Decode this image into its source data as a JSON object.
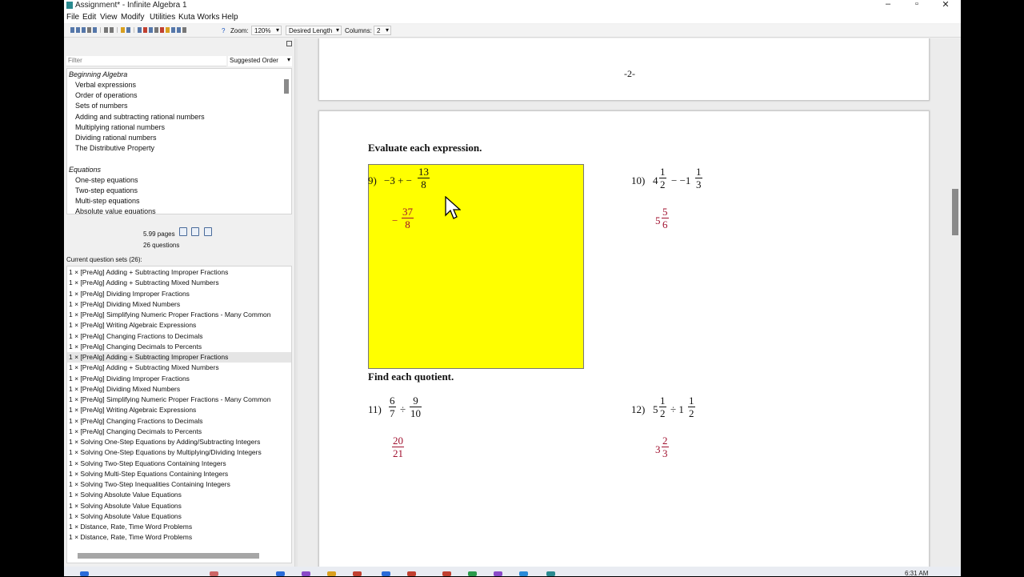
{
  "window": {
    "title": "Assignment* - Infinite Algebra 1",
    "controls": {
      "minimize": "–",
      "maximize": "▫",
      "close": "✕"
    }
  },
  "menu": [
    "File",
    "Edit",
    "View",
    "Modify",
    "Utilities",
    "Kuta Works",
    "Help"
  ],
  "toolbar": {
    "help": "?",
    "zoom_label": "Zoom:",
    "zoom_value": "120%",
    "length_value": "Desired Length",
    "columns_label": "Columns:",
    "columns_value": "2"
  },
  "left_pane": {
    "filter_placeholder": "Filter",
    "order_value": "Suggested Order",
    "topics": [
      {
        "group": "Beginning Algebra",
        "items": [
          "Verbal expressions",
          "Order of operations",
          "Sets of numbers",
          "Adding and subtracting rational numbers",
          "Multiplying rational numbers",
          "Dividing rational numbers",
          "The Distributive Property"
        ]
      },
      {
        "group": "Equations",
        "items": [
          "One-step equations",
          "Two-step equations",
          "Multi-step equations",
          "Absolute value equations"
        ]
      }
    ],
    "stats": {
      "pages": "5.99 pages",
      "questions": "26 questions"
    },
    "current_sets_label": "Current question sets (26):",
    "current_sets": [
      "1 × [PreAlg] Adding + Subtracting Improper Fractions",
      "1 × [PreAlg] Adding + Subtracting Mixed Numbers",
      "1 × [PreAlg] Dividing Improper Fractions",
      "1 × [PreAlg] Dividing Mixed Numbers",
      "1 × [PreAlg] Simplifying Numeric Proper Fractions - Many Common",
      "1 × [PreAlg] Writing Algebraic Expressions",
      "1 × [PreAlg] Changing Fractions to Decimals",
      "1 × [PreAlg] Changing Decimals to Percents",
      "1 × [PreAlg] Adding + Subtracting Improper Fractions",
      "1 × [PreAlg] Adding + Subtracting Mixed Numbers",
      "1 × [PreAlg] Dividing Improper Fractions",
      "1 × [PreAlg] Dividing Mixed Numbers",
      "1 × [PreAlg] Simplifying Numeric Proper Fractions - Many Common",
      "1 × [PreAlg] Writing Algebraic Expressions",
      "1 × [PreAlg] Changing Fractions to Decimals",
      "1 × [PreAlg] Changing Decimals to Percents",
      "1 × Solving One-Step Equations by Adding/Subtracting Integers",
      "1 × Solving One-Step Equations by Multiplying/Dividing Integers",
      "1 × Solving Two-Step Equations Containing Integers",
      "1 × Solving Multi-Step Equations Containing Integers",
      "1 × Solving Two-Step Inequalities Containing Integers",
      "1 × Solving Absolute Value Equations",
      "1 × Solving Absolute Value Equations",
      "1 × Solving Absolute Value Equations",
      "1 × Distance, Rate, Time Word Problems",
      "1 × Distance, Rate, Time Word Problems"
    ],
    "selected_index": 8
  },
  "document": {
    "page_number": "-2-",
    "section1_heading": "Evaluate each expression.",
    "section2_heading": "Find each quotient.",
    "q9": {
      "label": "9)",
      "lead": "−3 + −",
      "frac_n": "13",
      "frac_d": "8",
      "ans_sign": "−",
      "ans_n": "37",
      "ans_d": "8"
    },
    "q10": {
      "label": "10)",
      "w1": "4",
      "f1n": "1",
      "f1d": "2",
      "op": "− −1",
      "f2n": "1",
      "f2d": "3",
      "ans_w": "5",
      "ans_n": "5",
      "ans_d": "6"
    },
    "q11": {
      "label": "11)",
      "f1n": "6",
      "f1d": "7",
      "op": "÷",
      "f2n": "9",
      "f2d": "10",
      "ans_n": "20",
      "ans_d": "21"
    },
    "q12": {
      "label": "12)",
      "w1": "5",
      "f1n": "1",
      "f1d": "2",
      "op": "÷ 1",
      "f2n": "1",
      "f2d": "2",
      "ans_w": "3",
      "ans_n": "2",
      "ans_d": "3"
    },
    "highlight_color": "#ffff00",
    "answer_color": "#a0102e"
  },
  "taskbar": {
    "clock": "6:31 AM"
  }
}
